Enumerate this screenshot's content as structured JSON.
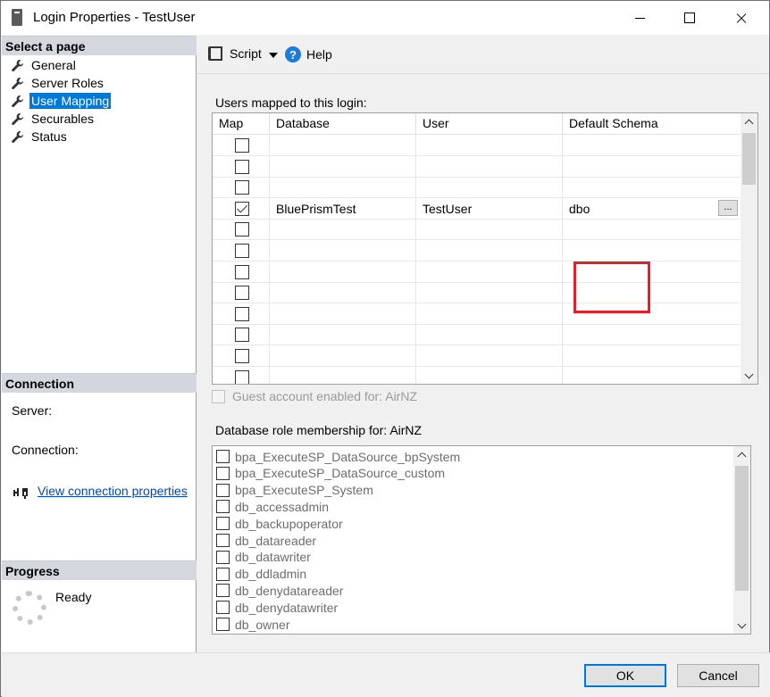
{
  "window": {
    "title": "Login Properties - TestUser"
  },
  "left": {
    "select_page_header": "Select a page",
    "nav": [
      {
        "label": "General",
        "selected": false
      },
      {
        "label": "Server Roles",
        "selected": false
      },
      {
        "label": "User Mapping",
        "selected": true
      },
      {
        "label": "Securables",
        "selected": false
      },
      {
        "label": "Status",
        "selected": false
      }
    ],
    "connection_header": "Connection",
    "server_label": "Server:",
    "connection_label": "Connection:",
    "view_connection_link": "View connection properties",
    "progress_header": "Progress",
    "progress_status": "Ready"
  },
  "toolbar": {
    "script_label": "Script",
    "help_label": "Help"
  },
  "mapping": {
    "label": "Users mapped to this login:",
    "columns": [
      "Map",
      "Database",
      "User",
      "Default Schema"
    ],
    "rows": [
      {
        "checked": false,
        "database": "",
        "user": "",
        "schema": ""
      },
      {
        "checked": false,
        "database": "",
        "user": "",
        "schema": ""
      },
      {
        "checked": false,
        "database": "",
        "user": "",
        "schema": ""
      },
      {
        "checked": true,
        "database": "BluePrismTest",
        "user": "TestUser",
        "schema": "dbo"
      },
      {
        "checked": false,
        "database": "",
        "user": "",
        "schema": ""
      },
      {
        "checked": false,
        "database": "",
        "user": "",
        "schema": ""
      },
      {
        "checked": false,
        "database": "",
        "user": "",
        "schema": ""
      },
      {
        "checked": false,
        "database": "",
        "user": "",
        "schema": ""
      },
      {
        "checked": false,
        "database": "",
        "user": "",
        "schema": ""
      },
      {
        "checked": false,
        "database": "",
        "user": "",
        "schema": ""
      },
      {
        "checked": false,
        "database": "",
        "user": "",
        "schema": ""
      },
      {
        "checked": false,
        "database": "",
        "user": "",
        "schema": ""
      }
    ],
    "ellipsis": "...",
    "highlight_color": "#e0202a"
  },
  "guest": {
    "label": "Guest account enabled for: AirNZ",
    "checked": false,
    "enabled": false
  },
  "roles": {
    "label": "Database role membership for: AirNZ",
    "items": [
      "bpa_ExecuteSP_DataSource_bpSystem",
      "bpa_ExecuteSP_DataSource_custom",
      "bpa_ExecuteSP_System",
      "db_accessadmin",
      "db_backupoperator",
      "db_datareader",
      "db_datawriter",
      "db_ddladmin",
      "db_denydatareader",
      "db_denydatawriter",
      "db_owner"
    ]
  },
  "buttons": {
    "ok": "OK",
    "cancel": "Cancel"
  },
  "colors": {
    "selection": "#0078d7",
    "link": "#0645ad"
  }
}
